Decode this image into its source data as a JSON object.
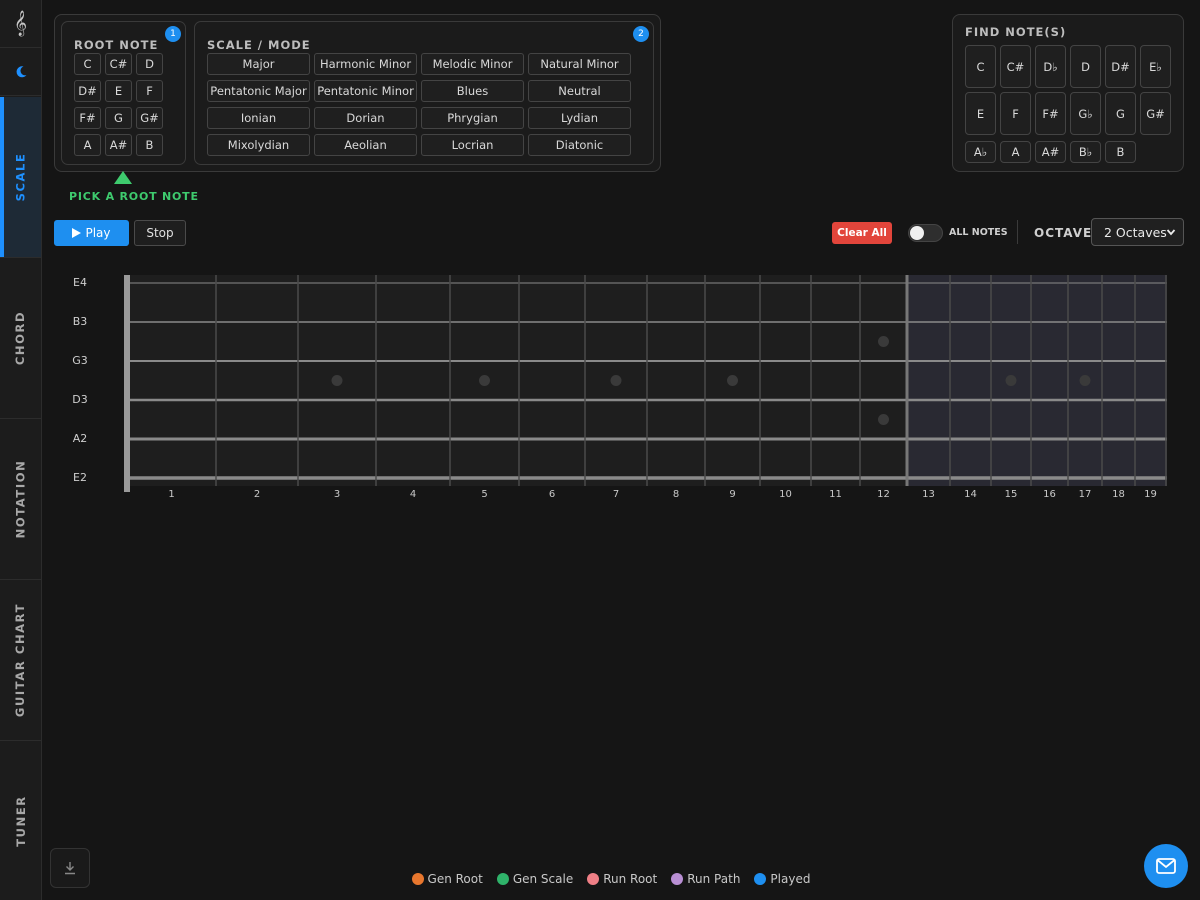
{
  "sidebar": {
    "logo_glyph": "𝄞",
    "tabs": [
      {
        "label": "SCALE",
        "active": true
      },
      {
        "label": "CHORD",
        "active": false
      },
      {
        "label": "NOTATION",
        "active": false
      },
      {
        "label": "GUITAR CHART",
        "active": false
      },
      {
        "label": "TUNER",
        "active": false
      }
    ]
  },
  "root_note": {
    "title": "ROOT NOTE",
    "badge": "1",
    "notes": [
      "C",
      "C#",
      "D",
      "D#",
      "E",
      "F",
      "F#",
      "G",
      "G#",
      "A",
      "A#",
      "B"
    ],
    "hint": "PICK A ROOT NOTE"
  },
  "scale_mode": {
    "title": "SCALE / MODE",
    "badge": "2",
    "options": [
      "Major",
      "Harmonic Minor",
      "Melodic Minor",
      "Natural Minor",
      "Pentatonic Major",
      "Pentatonic Minor",
      "Blues",
      "Neutral",
      "Ionian",
      "Dorian",
      "Phrygian",
      "Lydian",
      "Mixolydian",
      "Aeolian",
      "Locrian",
      "Diatonic"
    ]
  },
  "find_notes": {
    "title": "FIND NOTE(S)",
    "row1": [
      "C",
      "C#",
      "D♭",
      "D",
      "D#",
      "E♭"
    ],
    "row2": [
      "E",
      "F",
      "F#",
      "G♭",
      "G",
      "G#"
    ],
    "row3": [
      "A♭",
      "A",
      "A#",
      "B♭",
      "B"
    ]
  },
  "controls": {
    "play_label": "Play",
    "stop_label": "Stop",
    "clear_label": "Clear All",
    "all_notes_label": "ALL NOTES",
    "all_notes_on": false,
    "octaves_label": "OCTAVES",
    "octaves_value": "2 Octaves"
  },
  "fretboard": {
    "strings": [
      "E4",
      "B3",
      "G3",
      "D3",
      "A2",
      "E2"
    ],
    "frets": [
      "1",
      "2",
      "3",
      "4",
      "5",
      "6",
      "7",
      "8",
      "9",
      "10",
      "11",
      "12",
      "13",
      "14",
      "15",
      "16",
      "17",
      "18",
      "19"
    ],
    "inlay_frets_single": [
      3,
      5,
      7,
      9,
      15,
      17
    ],
    "inlay_frets_double": [
      12
    ],
    "highlight_from_fret": 13
  },
  "legend": [
    {
      "label": "Gen Root",
      "color": "#e8772e"
    },
    {
      "label": "Gen Scale",
      "color": "#2fb36a"
    },
    {
      "label": "Run Root",
      "color": "#ef7f86"
    },
    {
      "label": "Run Path",
      "color": "#b98fd4"
    },
    {
      "label": "Played",
      "color": "#1e8ff0"
    }
  ],
  "colors": {
    "accent": "#1e8ff0",
    "hint": "#3ecb6e",
    "danger": "#e2453b"
  }
}
